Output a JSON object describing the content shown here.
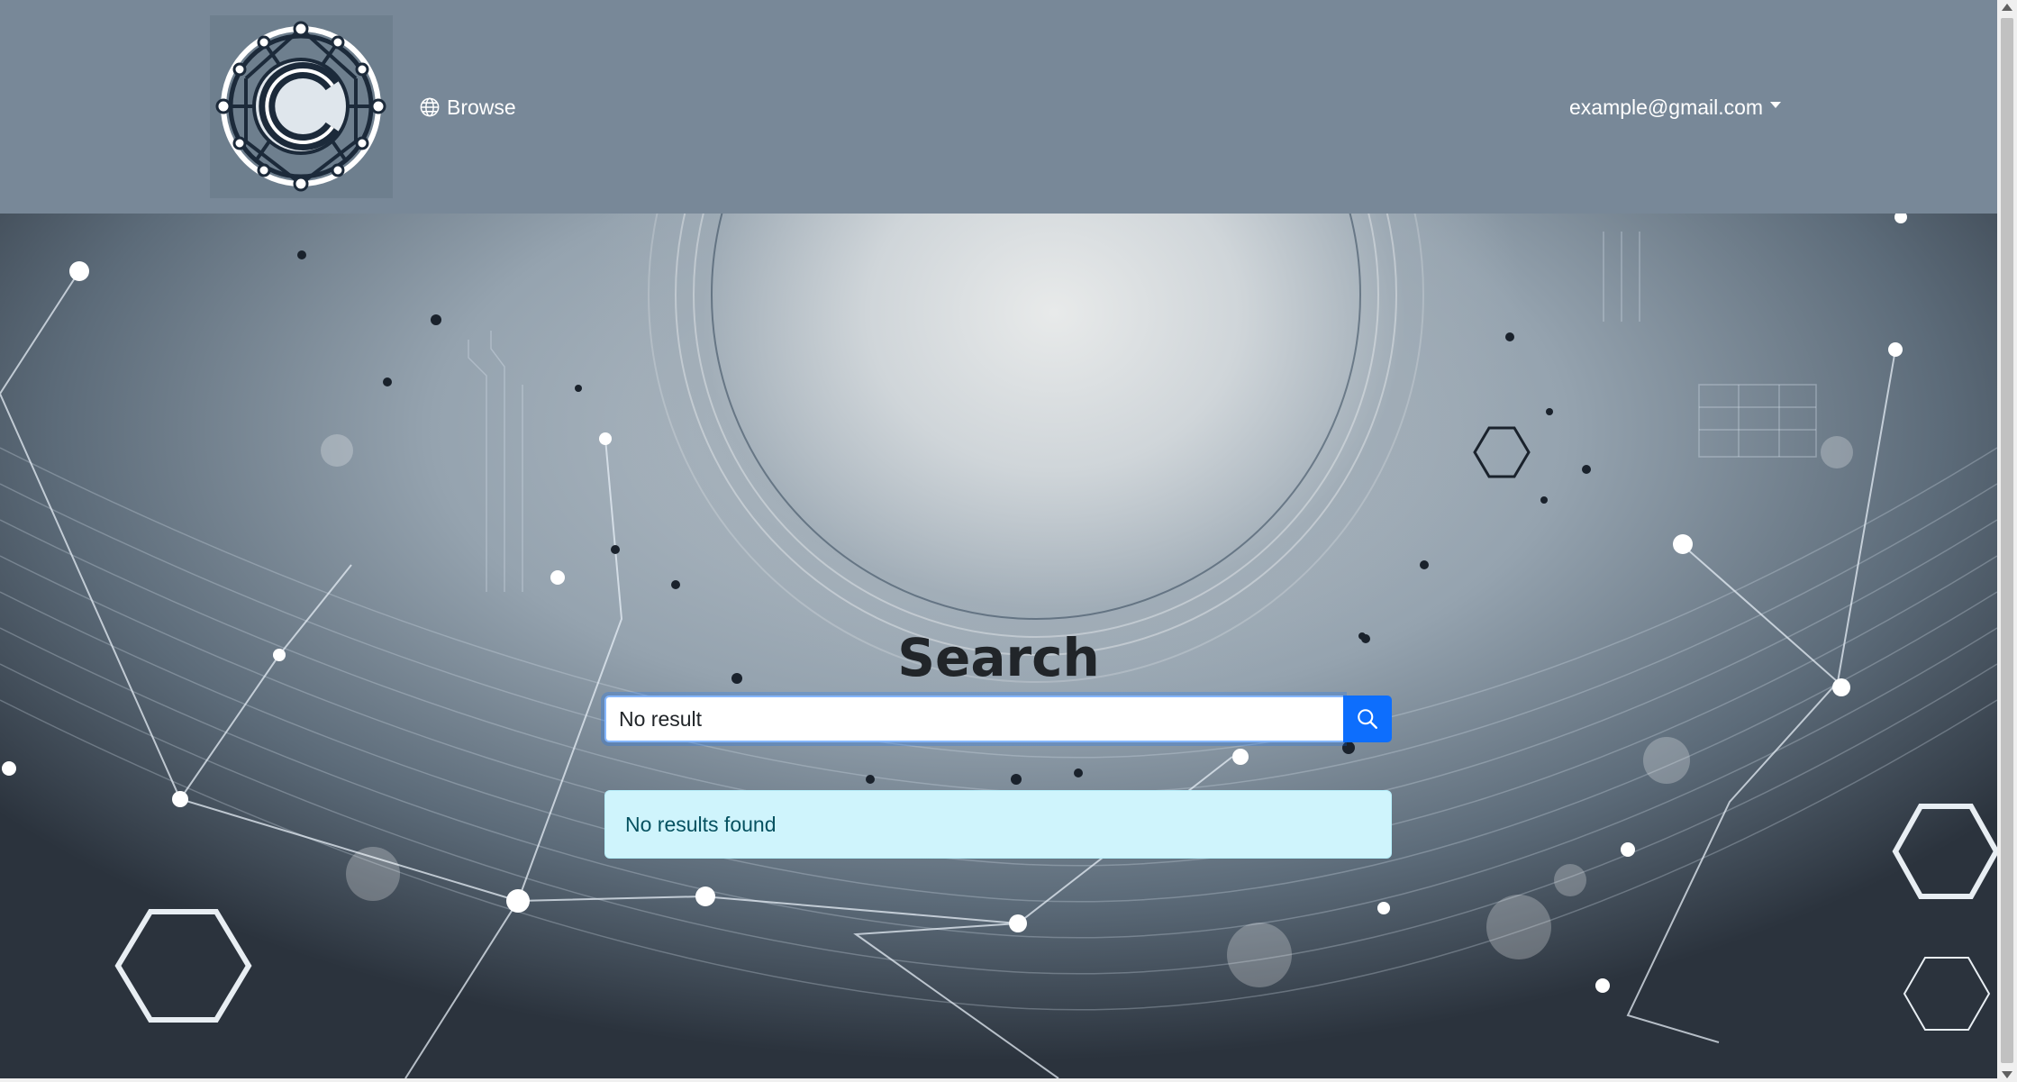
{
  "navbar": {
    "logo_icon": "circuit-c-logo",
    "browse_label": "Browse",
    "browse_icon": "globe-icon",
    "user_email": "example@gmail.com"
  },
  "search": {
    "title": "Search",
    "input_value": "No result",
    "button_icon": "search-icon"
  },
  "results": {
    "message": "No results found"
  },
  "colors": {
    "navbar_bg": "#788898",
    "primary": "#0d6efd",
    "alert_bg": "#cff4fc",
    "alert_text": "#055160"
  }
}
